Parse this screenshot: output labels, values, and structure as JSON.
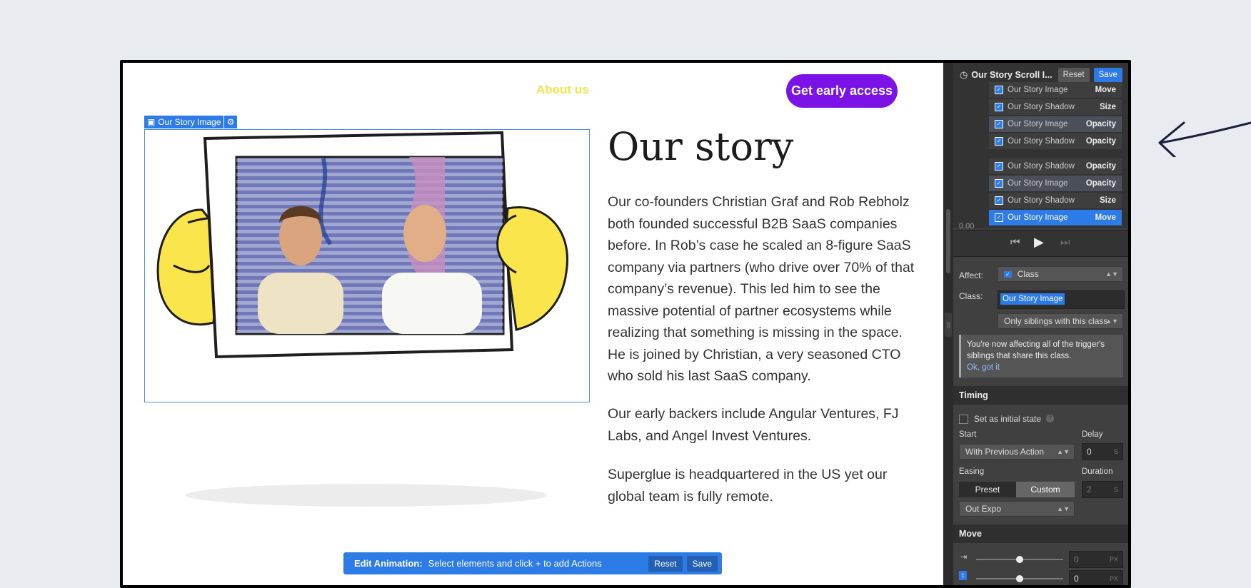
{
  "site": {
    "nav_link": "About us",
    "cta": "Get early access",
    "selection_label": "Our Story Image",
    "title": "Our story",
    "paragraphs": [
      "Our co-founders Christian Graf and Rob Rebholz both founded successful B2B SaaS companies before. In Rob’s case he scaled an 8-figure SaaS company via partners (who drive over 70% of that company’s revenue). This led him to see the massive potential of partner ecosystems while realizing that something is missing in the space. He is joined by Christian, a very seasoned CTO who sold his last SaaS company.",
      "Our early backers include Angular Ventures, FJ Labs, and Angel Invest Ventures.",
      "Superglue is headquartered in the US yet our global team is fully remote."
    ]
  },
  "edit_bar": {
    "label": "Edit Animation:",
    "message": "Select elements and click + to add Actions",
    "reset": "Reset",
    "save": "Save"
  },
  "panel": {
    "title": "Our Story Scroll I...",
    "reset": "Reset",
    "save": "Save",
    "timeline_time": "0.00",
    "timeline": [
      {
        "name": "Our Story Image",
        "type": "Move",
        "style": "partial"
      },
      {
        "name": "Our Story Shadow",
        "type": "Size",
        "style": "normal"
      },
      {
        "name": "Our Story Image",
        "type": "Opacity",
        "style": "alt"
      },
      {
        "name": "Our Story Shadow",
        "type": "Opacity",
        "style": "normal"
      },
      {
        "name": "Our Story Shadow",
        "type": "Opacity",
        "style": "normal"
      },
      {
        "name": "Our Story Image",
        "type": "Opacity",
        "style": "alt"
      },
      {
        "name": "Our Story Shadow",
        "type": "Size",
        "style": "normal"
      },
      {
        "name": "Our Story Image",
        "type": "Move",
        "style": "selected"
      }
    ],
    "affect_label": "Affect:",
    "affect_value": "Class",
    "class_label": "Class:",
    "class_value": "Our Story Image",
    "siblings_option": "Only siblings with this class",
    "note": "You're now affecting all of the trigger's siblings that share this class.",
    "note_ok": "Ok, got it",
    "timing": {
      "heading": "Timing",
      "initial_state": "Set as initial state",
      "start_label": "Start",
      "start_value": "With Previous Action",
      "delay_label": "Delay",
      "delay_value": "0",
      "easing_label": "Easing",
      "preset": "Preset",
      "custom": "Custom",
      "duration_label": "Duration",
      "duration_value": "2",
      "easing_value": "Out Expo",
      "unit_s": "S"
    },
    "move": {
      "heading": "Move",
      "x_value": "0",
      "y_value": "0",
      "unit": "PX"
    }
  }
}
